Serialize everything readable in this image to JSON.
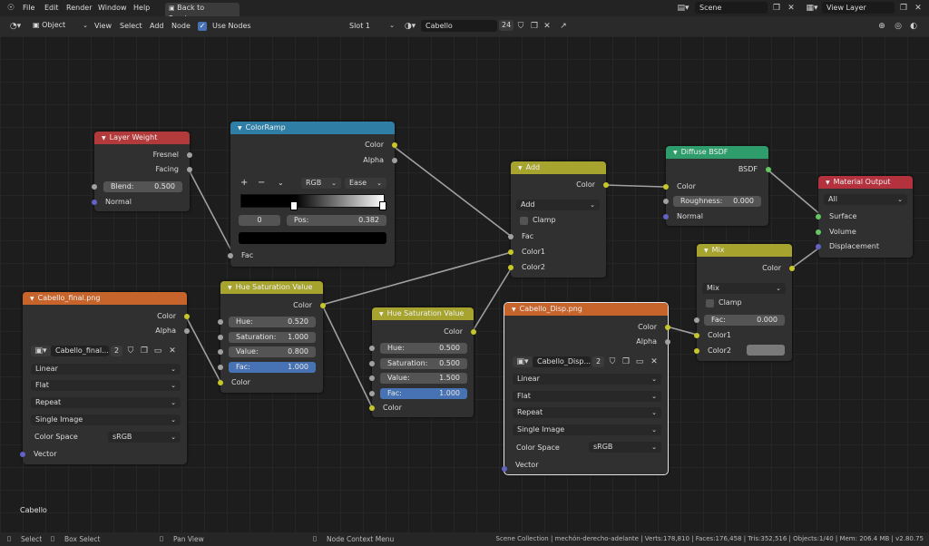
{
  "menu": {
    "file": "File",
    "edit": "Edit",
    "render": "Render",
    "window": "Window",
    "help": "Help",
    "back": "Back to Previous",
    "scene": "Scene",
    "view_layer": "View Layer"
  },
  "header": {
    "mode": "Object",
    "view": "View",
    "select": "Select",
    "add": "Add",
    "node": "Node",
    "use_nodes": "Use Nodes",
    "slot": "Slot 1",
    "material": "Cabello",
    "users": "24"
  },
  "nodes": {
    "layer_weight": {
      "title": "Layer Weight",
      "fresnel": "Fresnel",
      "facing": "Facing",
      "blend_label": "Blend:",
      "blend_value": "0.500",
      "normal": "Normal"
    },
    "colorramp": {
      "title": "ColorRamp",
      "color": "Color",
      "alpha": "Alpha",
      "plus": "+",
      "minus": "−",
      "mode": "RGB",
      "interp": "Ease",
      "index": "0",
      "pos_label": "Pos:",
      "pos_value": "0.382",
      "fac": "Fac"
    },
    "add": {
      "title": "Add",
      "color": "Color",
      "op": "Add",
      "clamp": "Clamp",
      "fac": "Fac",
      "color1": "Color1",
      "color2": "Color2"
    },
    "diffuse": {
      "title": "Diffuse BSDF",
      "bsdf": "BSDF",
      "color": "Color",
      "roughness_label": "Roughness:",
      "roughness_value": "0.000",
      "normal": "Normal"
    },
    "output": {
      "title": "Material Output",
      "target": "All",
      "surface": "Surface",
      "volume": "Volume",
      "displacement": "Displacement"
    },
    "mix": {
      "title": "Mix",
      "color": "Color",
      "op": "Mix",
      "clamp": "Clamp",
      "fac_label": "Fac:",
      "fac_value": "0.000",
      "color1": "Color1",
      "color2": "Color2"
    },
    "img_final": {
      "title": "Cabello_final.png",
      "color": "Color",
      "alpha": "Alpha",
      "image": "Cabello_final...",
      "users": "2",
      "interp": "Linear",
      "proj": "Flat",
      "ext": "Repeat",
      "source": "Single Image",
      "cs_label": "Color Space",
      "cs_value": "sRGB",
      "vector": "Vector"
    },
    "hsv1": {
      "title": "Hue Saturation Value",
      "color_out": "Color",
      "hue_label": "Hue:",
      "hue": "0.520",
      "sat_label": "Saturation:",
      "sat": "1.000",
      "val_label": "Value:",
      "val": "0.800",
      "fac_label": "Fac:",
      "fac": "1.000",
      "color_in": "Color"
    },
    "hsv2": {
      "title": "Hue Saturation Value",
      "color_out": "Color",
      "hue_label": "Hue:",
      "hue": "0.500",
      "sat_label": "Saturation:",
      "sat": "0.500",
      "val_label": "Value:",
      "val": "1.500",
      "fac_label": "Fac:",
      "fac": "1.000",
      "color_in": "Color"
    },
    "img_disp": {
      "title": "Cabello_Disp.png",
      "color": "Color",
      "alpha": "Alpha",
      "image": "Cabello_Disp...",
      "users": "2",
      "interp": "Linear",
      "proj": "Flat",
      "ext": "Repeat",
      "source": "Single Image",
      "cs_label": "Color Space",
      "cs_value": "sRGB",
      "vector": "Vector"
    }
  },
  "canvas_label": "Cabello",
  "status": {
    "select": "Select",
    "box_select": "Box Select",
    "pan_view": "Pan View",
    "context_menu": "Node Context Menu",
    "stats": "Scene Collection | mechón-derecho-adelante | Verts:178,810 | Faces:176,458 | Tris:352,516 | Objects:1/40 | Mem: 206.4 MB | v2.80.75"
  },
  "colors": {
    "converter": "#2e7ea5",
    "input": "#b33a3a",
    "color": "#a6a32e",
    "shader": "#2e9c6b",
    "output": "#b3323e",
    "texture": "#c7642c",
    "socket_color": "#c7c729",
    "socket_float": "#a1a1a1",
    "socket_shader": "#63c763",
    "socket_vector": "#6363c7",
    "selection": "#4772b3"
  }
}
